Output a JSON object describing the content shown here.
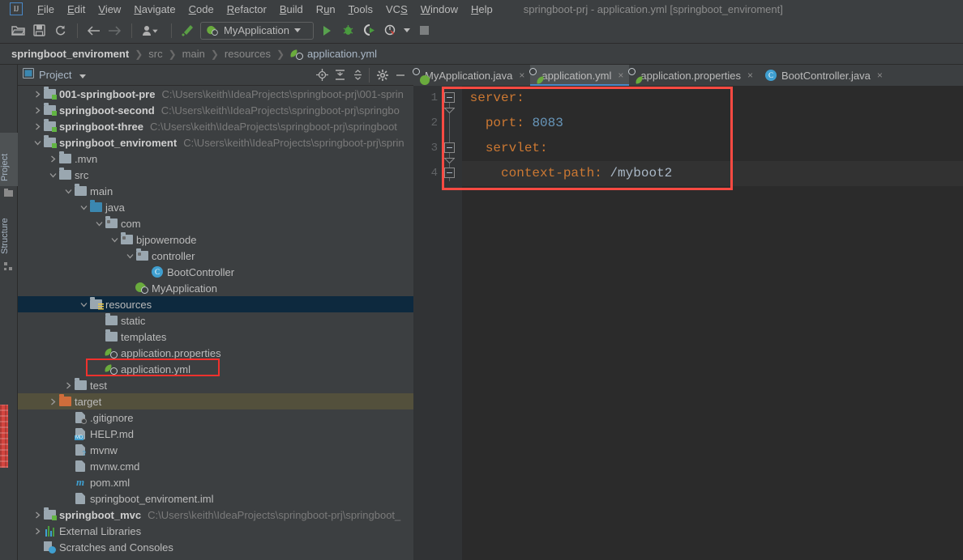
{
  "window": {
    "title": "springboot-prj - application.yml [springboot_enviroment]",
    "logo_text": "IJ"
  },
  "menubar": {
    "items": [
      {
        "label": "File",
        "mnemonic": "F"
      },
      {
        "label": "Edit",
        "mnemonic": "E"
      },
      {
        "label": "View",
        "mnemonic": "V"
      },
      {
        "label": "Navigate",
        "mnemonic": "N"
      },
      {
        "label": "Code",
        "mnemonic": "C"
      },
      {
        "label": "Refactor",
        "mnemonic": "R"
      },
      {
        "label": "Build",
        "mnemonic": "B"
      },
      {
        "label": "Run",
        "mnemonic": "u"
      },
      {
        "label": "Tools",
        "mnemonic": "T"
      },
      {
        "label": "VCS",
        "mnemonic": "S"
      },
      {
        "label": "Window",
        "mnemonic": "W"
      },
      {
        "label": "Help",
        "mnemonic": "H"
      }
    ]
  },
  "toolbar": {
    "open_label": "Open",
    "save_label": "Save All",
    "sync_label": "Synchronize",
    "back_label": "Back",
    "forward_label": "Forward",
    "profile_label": "Profile",
    "build_label": "Build Project",
    "run_config": "MyApplication",
    "run_label": "Run",
    "debug_label": "Debug",
    "coverage_label": "Run with Coverage",
    "profiler_label": "Profiler",
    "stop_label": "Stop"
  },
  "breadcrumb": {
    "items": [
      {
        "label": "springboot_enviroment",
        "style": "bold"
      },
      {
        "label": "src",
        "style": "dim"
      },
      {
        "label": "main",
        "style": "dim"
      },
      {
        "label": "resources",
        "style": "dim"
      },
      {
        "label": "application.yml",
        "style": "file"
      }
    ],
    "separator": "❯"
  },
  "tool_tabs": {
    "project": "Project",
    "structure": "Structure"
  },
  "project_panel": {
    "title": "Project",
    "dropdown_caret": "▾",
    "actions": [
      "locate-icon",
      "expand-all-icon",
      "collapse-all-icon",
      "settings-icon",
      "hide-icon"
    ]
  },
  "tree": {
    "rows": [
      {
        "indent": 0,
        "arrow": "right",
        "icon": "module-folder",
        "name": "001-springboot-pre",
        "bold": true,
        "path": "C:\\Users\\keith\\IdeaProjects\\springboot-prj\\001-sprin",
        "state": "normal"
      },
      {
        "indent": 0,
        "arrow": "right",
        "icon": "module-folder",
        "name": "springboot-second",
        "bold": true,
        "path": "C:\\Users\\keith\\IdeaProjects\\springboot-prj\\springbo",
        "state": "normal"
      },
      {
        "indent": 0,
        "arrow": "right",
        "icon": "module-folder",
        "name": "springboot-three",
        "bold": true,
        "path": "C:\\Users\\keith\\IdeaProjects\\springboot-prj\\springboot",
        "state": "normal"
      },
      {
        "indent": 0,
        "arrow": "down",
        "icon": "module-folder",
        "name": "springboot_enviroment",
        "bold": true,
        "path": "C:\\Users\\keith\\IdeaProjects\\springboot-prj\\sprin",
        "state": "normal"
      },
      {
        "indent": 1,
        "arrow": "right",
        "icon": "folder",
        "name": ".mvn",
        "bold": false,
        "path": "",
        "state": "normal"
      },
      {
        "indent": 1,
        "arrow": "down",
        "icon": "folder",
        "name": "src",
        "bold": false,
        "path": "",
        "state": "normal"
      },
      {
        "indent": 2,
        "arrow": "down",
        "icon": "folder",
        "name": "main",
        "bold": false,
        "path": "",
        "state": "normal"
      },
      {
        "indent": 3,
        "arrow": "down",
        "icon": "folder-source",
        "name": "java",
        "bold": false,
        "path": "",
        "state": "normal"
      },
      {
        "indent": 4,
        "arrow": "down",
        "icon": "package",
        "name": "com",
        "bold": false,
        "path": "",
        "state": "normal"
      },
      {
        "indent": 5,
        "arrow": "down",
        "icon": "package",
        "name": "bjpowernode",
        "bold": false,
        "path": "",
        "state": "normal"
      },
      {
        "indent": 6,
        "arrow": "down",
        "icon": "package",
        "name": "controller",
        "bold": false,
        "path": "",
        "state": "normal"
      },
      {
        "indent": 7,
        "arrow": "none",
        "icon": "java-class",
        "name": "BootController",
        "bold": false,
        "path": "",
        "state": "normal"
      },
      {
        "indent": 6,
        "arrow": "none",
        "icon": "spring-app",
        "name": "MyApplication",
        "bold": false,
        "path": "",
        "state": "normal"
      },
      {
        "indent": 3,
        "arrow": "down",
        "icon": "folder-resources",
        "name": "resources",
        "bold": false,
        "path": "",
        "state": "selected"
      },
      {
        "indent": 4,
        "arrow": "none",
        "icon": "folder",
        "name": "static",
        "bold": false,
        "path": "",
        "state": "normal"
      },
      {
        "indent": 4,
        "arrow": "none",
        "icon": "folder",
        "name": "templates",
        "bold": false,
        "path": "",
        "state": "normal"
      },
      {
        "indent": 4,
        "arrow": "none",
        "icon": "spring-config",
        "name": "application.properties",
        "bold": false,
        "path": "",
        "state": "normal"
      },
      {
        "indent": 4,
        "arrow": "none",
        "icon": "spring-config",
        "name": "application.yml",
        "bold": false,
        "path": "",
        "state": "highlighted"
      },
      {
        "indent": 2,
        "arrow": "right",
        "icon": "folder",
        "name": "test",
        "bold": false,
        "path": "",
        "state": "normal"
      },
      {
        "indent": 1,
        "arrow": "right",
        "icon": "folder-excluded",
        "name": "target",
        "bold": false,
        "path": "",
        "state": "excluded"
      },
      {
        "indent": 2,
        "arrow": "none",
        "icon": "gitignore-file",
        "name": ".gitignore",
        "bold": false,
        "path": "",
        "state": "normal"
      },
      {
        "indent": 2,
        "arrow": "none",
        "icon": "markdown-file",
        "name": "HELP.md",
        "bold": false,
        "path": "",
        "state": "normal"
      },
      {
        "indent": 2,
        "arrow": "none",
        "icon": "shell-file",
        "name": "mvnw",
        "bold": false,
        "path": "",
        "state": "normal"
      },
      {
        "indent": 2,
        "arrow": "none",
        "icon": "cmd-file",
        "name": "mvnw.cmd",
        "bold": false,
        "path": "",
        "state": "normal"
      },
      {
        "indent": 2,
        "arrow": "none",
        "icon": "maven-file",
        "name": "pom.xml",
        "bold": false,
        "path": "",
        "state": "normal"
      },
      {
        "indent": 2,
        "arrow": "none",
        "icon": "iml-file",
        "name": "springboot_enviroment.iml",
        "bold": false,
        "path": "",
        "state": "normal"
      },
      {
        "indent": 0,
        "arrow": "right",
        "icon": "module-folder",
        "name": "springboot_mvc",
        "bold": true,
        "path": "C:\\Users\\keith\\IdeaProjects\\springboot-prj\\springboot_",
        "state": "normal"
      },
      {
        "indent": 0,
        "arrow": "right",
        "icon": "external-libraries",
        "name": "External Libraries",
        "bold": false,
        "path": "",
        "state": "normal"
      },
      {
        "indent": 0,
        "arrow": "none",
        "icon": "scratches",
        "name": "Scratches and Consoles",
        "bold": false,
        "path": "",
        "state": "normal"
      }
    ]
  },
  "editor_tabs": {
    "close_glyph": "×",
    "items": [
      {
        "label": "MyApplication.java",
        "icon": "spring-app",
        "active": false
      },
      {
        "label": "application.yml",
        "icon": "spring-config",
        "active": true
      },
      {
        "label": "application.properties",
        "icon": "spring-config",
        "active": false
      },
      {
        "label": "BootController.java",
        "icon": "java-class",
        "active": false
      }
    ]
  },
  "editor": {
    "filename": "application.yml",
    "line_numbers": [
      "1",
      "2",
      "3",
      "4"
    ],
    "caret_line": 4,
    "lines": [
      {
        "num": 1,
        "indent": 0,
        "key": "server",
        "colon": ":",
        "value": "",
        "value_type": "none",
        "fold": "start"
      },
      {
        "num": 2,
        "indent": 2,
        "key": "port",
        "colon": ":",
        "value": "8083",
        "value_type": "number",
        "fold": "none"
      },
      {
        "num": 3,
        "indent": 2,
        "key": "servlet",
        "colon": ":",
        "value": "",
        "value_type": "none",
        "fold": "start"
      },
      {
        "num": 4,
        "indent": 4,
        "key": "context-path",
        "colon": ":",
        "value": "/myboot2",
        "value_type": "string",
        "fold": "start"
      }
    ],
    "raw_text": "server:\n  port: 8083\n  servlet:\n    context-path: /myboot2"
  },
  "annotations": [
    {
      "name": "code-highlight-box",
      "color": "#fb4a42"
    },
    {
      "name": "tree-file-highlight-box",
      "color": "#f0312d"
    }
  ],
  "colors": {
    "accent": "#4a88c7",
    "keyword": "#cc7832",
    "number": "#6897bb",
    "string": "#a9b7c6",
    "selection": "#0d293e",
    "excluded": "#53503c",
    "annotation_red": "#fb4a42"
  }
}
